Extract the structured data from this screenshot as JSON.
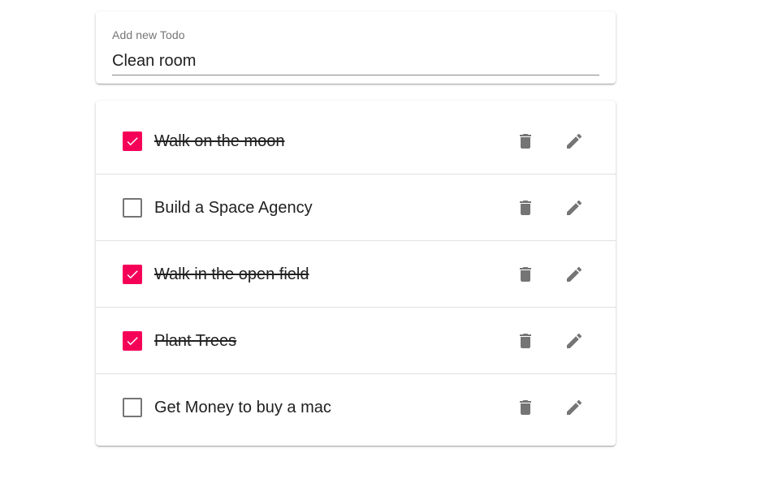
{
  "new_todo": {
    "label": "Add new Todo",
    "value": "Clean room"
  },
  "todos": [
    {
      "text": "Walk on the moon",
      "completed": true
    },
    {
      "text": "Build a Space Agency",
      "completed": false
    },
    {
      "text": "Walk in the open field",
      "completed": true
    },
    {
      "text": "Plant Trees",
      "completed": true
    },
    {
      "text": "Get Money to buy a mac",
      "completed": false
    }
  ],
  "colors": {
    "accent": "#f50057",
    "icon": "#757575",
    "text": "#212121"
  },
  "icons": {
    "delete": "trash-icon",
    "edit": "pencil-icon",
    "checked": "checkmark-icon"
  }
}
